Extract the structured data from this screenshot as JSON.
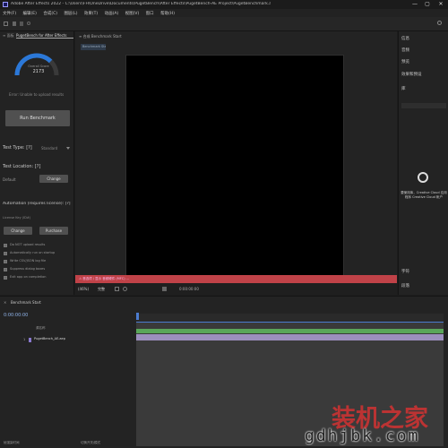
{
  "window": {
    "title": "Adobe After Effects 2022 - C:\\Users\\FH\\OneDrive\\Documents\\PugetBench\\After Effects\\PugetBench-AE Project\\PugetBenchmark.aep",
    "minimize": "—",
    "maximize": "▢",
    "close": "✕"
  },
  "menu": [
    "文件(F)",
    "编辑(E)",
    "合成(C)",
    "图层(L)",
    "效果(T)",
    "动画(A)",
    "视图(V)",
    "窗口",
    "帮助(H)"
  ],
  "left_panel": {
    "tab": "PugetBench for After Effects",
    "tab_prefix": "≡ 面板",
    "gauge": {
      "label": "Overall Score",
      "value": "2173",
      "fraction": 0.75
    },
    "error_text": "Error: Unable to upload results",
    "run_button": "Run Benchmark",
    "test_type_label": "Test Type: [?]",
    "test_type_value": "Standard",
    "test_location_label": "Test Location: [?]",
    "location_value": "Default",
    "change_button": "Change",
    "automation_label": "Automation (requires license): [?]",
    "license_key_label": "License Key (ID#)",
    "change_button_2": "Change",
    "purchase_button": "Purchase",
    "checkboxes": [
      "Do NOT upload results",
      "Automatically run on startup",
      "Write CSV/JSON log file",
      "Suppress dialog boxes",
      "Exit app on completion"
    ]
  },
  "center": {
    "comp_tab": "≡ 合成 Benchmark Start",
    "comp_chip": "Benchmark Start",
    "error_bar": "⚠ 首选项 / 显示 音频硬件  (MFC) ...",
    "zoom": "(46%)",
    "quality": "完整",
    "timecode": "0:00:00:00"
  },
  "right_panel": {
    "items": [
      "信息",
      "音频",
      "预览",
      "效果和预设",
      "库"
    ],
    "library_prompt": "要使用库，Creative Cloud 应用程序 Creative Cloud 帐户",
    "bottom_items": [
      "字符",
      "段落"
    ]
  },
  "timeline": {
    "tab": "Benchmark Start",
    "timecode": "0:00:00:00",
    "layer_number": "1",
    "layer_name": "PugetBench_AE.aep",
    "source_col": "源名称",
    "toggle_label": "切换开关/模式",
    "footer_left": "帧渲染时间"
  },
  "watermark": {
    "cn": "装机之家",
    "url": "gdhjbk.com"
  }
}
